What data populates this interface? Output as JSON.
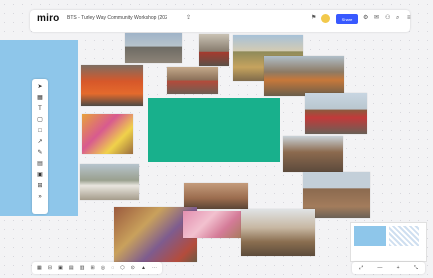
{
  "app": {
    "logo": "miro"
  },
  "header": {
    "board_title": "BTS - Turley Way Community Workshop (2020)",
    "share_label": "Share"
  },
  "colors": {
    "sticky": "#18b08c",
    "frame_accent": "#8ec6ea",
    "share_button": "#3859ff"
  },
  "icons": {
    "upload": "upload-icon",
    "settings": "settings-icon",
    "notifications": "bell-icon",
    "search": "search-icon",
    "menu": "menu-icon"
  },
  "left_toolbar": [
    {
      "name": "select-tool",
      "glyph": "➤"
    },
    {
      "name": "templates-tool",
      "glyph": "▦"
    },
    {
      "name": "text-tool",
      "glyph": "T"
    },
    {
      "name": "sticky-tool",
      "glyph": "▢"
    },
    {
      "name": "shape-tool",
      "glyph": "□"
    },
    {
      "name": "line-tool",
      "glyph": "↗"
    },
    {
      "name": "pen-tool",
      "glyph": "✎"
    },
    {
      "name": "comment-tool",
      "glyph": "▤"
    },
    {
      "name": "frame-tool",
      "glyph": "▣"
    },
    {
      "name": "apps-tool",
      "glyph": "⊞"
    },
    {
      "name": "more-tool",
      "glyph": "»"
    }
  ],
  "bottom_tools": [
    "▦",
    "⊟",
    "▣",
    "▤",
    "▥",
    "⊞",
    "◎",
    "◌",
    "⬡",
    "⊙",
    "▲",
    "⋯"
  ],
  "zoom_bar": [
    "⤢",
    "—",
    "+",
    "⤡"
  ]
}
